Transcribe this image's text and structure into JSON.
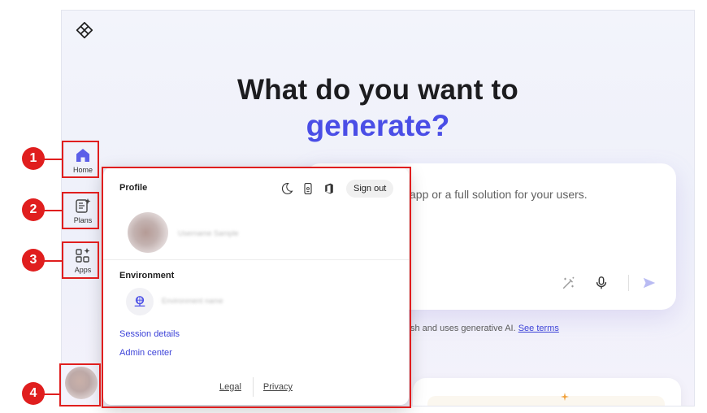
{
  "hero": {
    "line1": "What do you want to",
    "line2": "generate?"
  },
  "prompt": {
    "text": "app or a full solution for your users."
  },
  "disclaimer": {
    "text": "sh and uses generative AI. ",
    "link": "See terms"
  },
  "nav": {
    "home": "Home",
    "plans": "Plans",
    "apps": "Apps"
  },
  "callouts": [
    "1",
    "2",
    "3",
    "4"
  ],
  "profile_popup": {
    "profile_title": "Profile",
    "sign_out": "Sign out",
    "username": "Username Sample",
    "environment_title": "Environment",
    "environment_name": "Environment name",
    "session_details": "Session details",
    "admin_center": "Admin center",
    "legal": "Legal",
    "privacy": "Privacy"
  },
  "colors": {
    "accent": "#4a4ee6",
    "callout": "#e01e1e",
    "home_icon": "#5b5fe8"
  }
}
